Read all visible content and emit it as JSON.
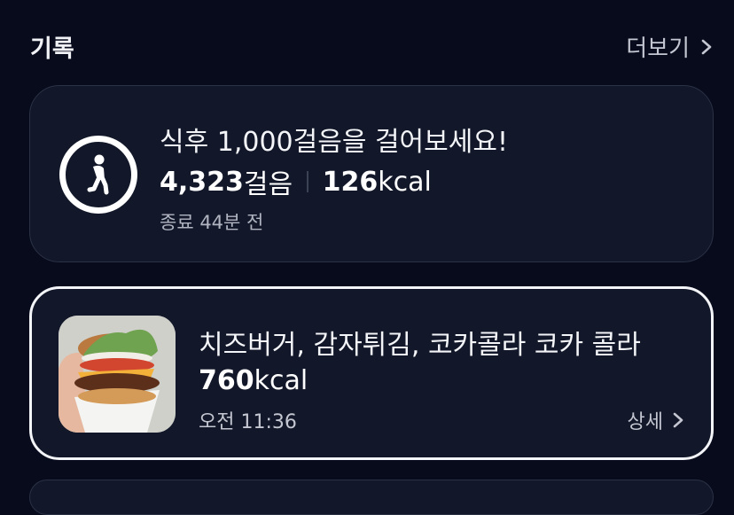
{
  "header": {
    "title": "기록",
    "more_label": "더보기",
    "more_icon": "chevron-right-icon"
  },
  "steps_card": {
    "icon": "walking-person-icon",
    "prompt": "식후 1,000걸음을 걸어보세요!",
    "steps_value": "4,323",
    "steps_unit": "걸음",
    "kcal_value": "126",
    "kcal_unit": "kcal",
    "ended": "종료 44분 전"
  },
  "meal_card": {
    "photo": "burger-photo",
    "name": "치즈버거, 감자튀김, 코카콜라 코카 콜라",
    "kcal_value": "760",
    "kcal_unit": "kcal",
    "time": "오전 11:36",
    "detail_label": "상세",
    "detail_icon": "chevron-right-icon"
  },
  "colors": {
    "background": "#070b1c",
    "card": "#121829",
    "card_border": "#2b3245",
    "selected_border": "#f4f5f8",
    "secondary_text": "#c4c7d2"
  }
}
